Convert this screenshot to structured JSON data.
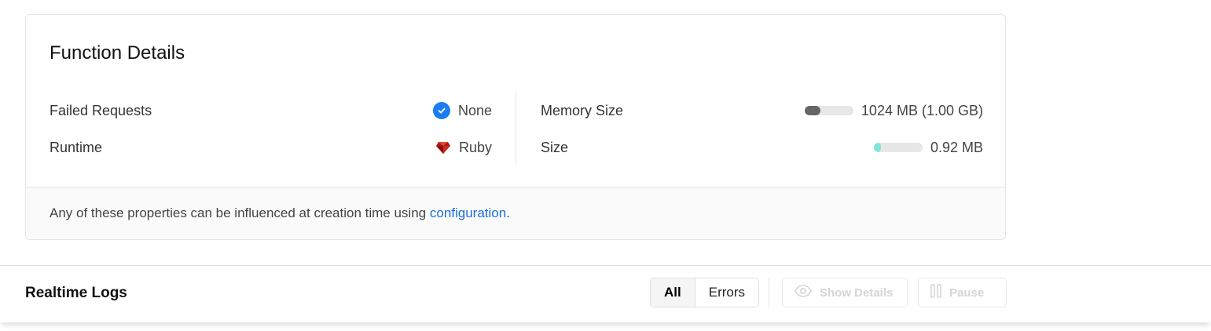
{
  "function_details": {
    "title": "Function Details",
    "failed_requests": {
      "label": "Failed Requests",
      "value": "None",
      "icon": "check-circle-icon",
      "icon_color": "#1c7cf2"
    },
    "runtime": {
      "label": "Runtime",
      "value": "Ruby",
      "icon": "ruby-icon"
    },
    "memory_size": {
      "label": "Memory Size",
      "value": "1024 MB (1.00 GB)",
      "usage_fraction": 0.33,
      "bar_color": "#666666"
    },
    "size": {
      "label": "Size",
      "value": "0.92 MB",
      "usage_fraction": 0.15,
      "bar_color": "#7de8d8"
    },
    "footer": {
      "text_before": "Any of these properties can be influenced at creation time using ",
      "link_text": "configuration",
      "text_after": ".",
      "link_color": "#1a6ed8"
    }
  },
  "realtime_logs": {
    "title": "Realtime Logs",
    "filters": [
      {
        "label": "All",
        "active": true
      },
      {
        "label": "Errors",
        "active": false
      }
    ],
    "show_details_label": "Show Details",
    "pause_label": "Pause"
  }
}
